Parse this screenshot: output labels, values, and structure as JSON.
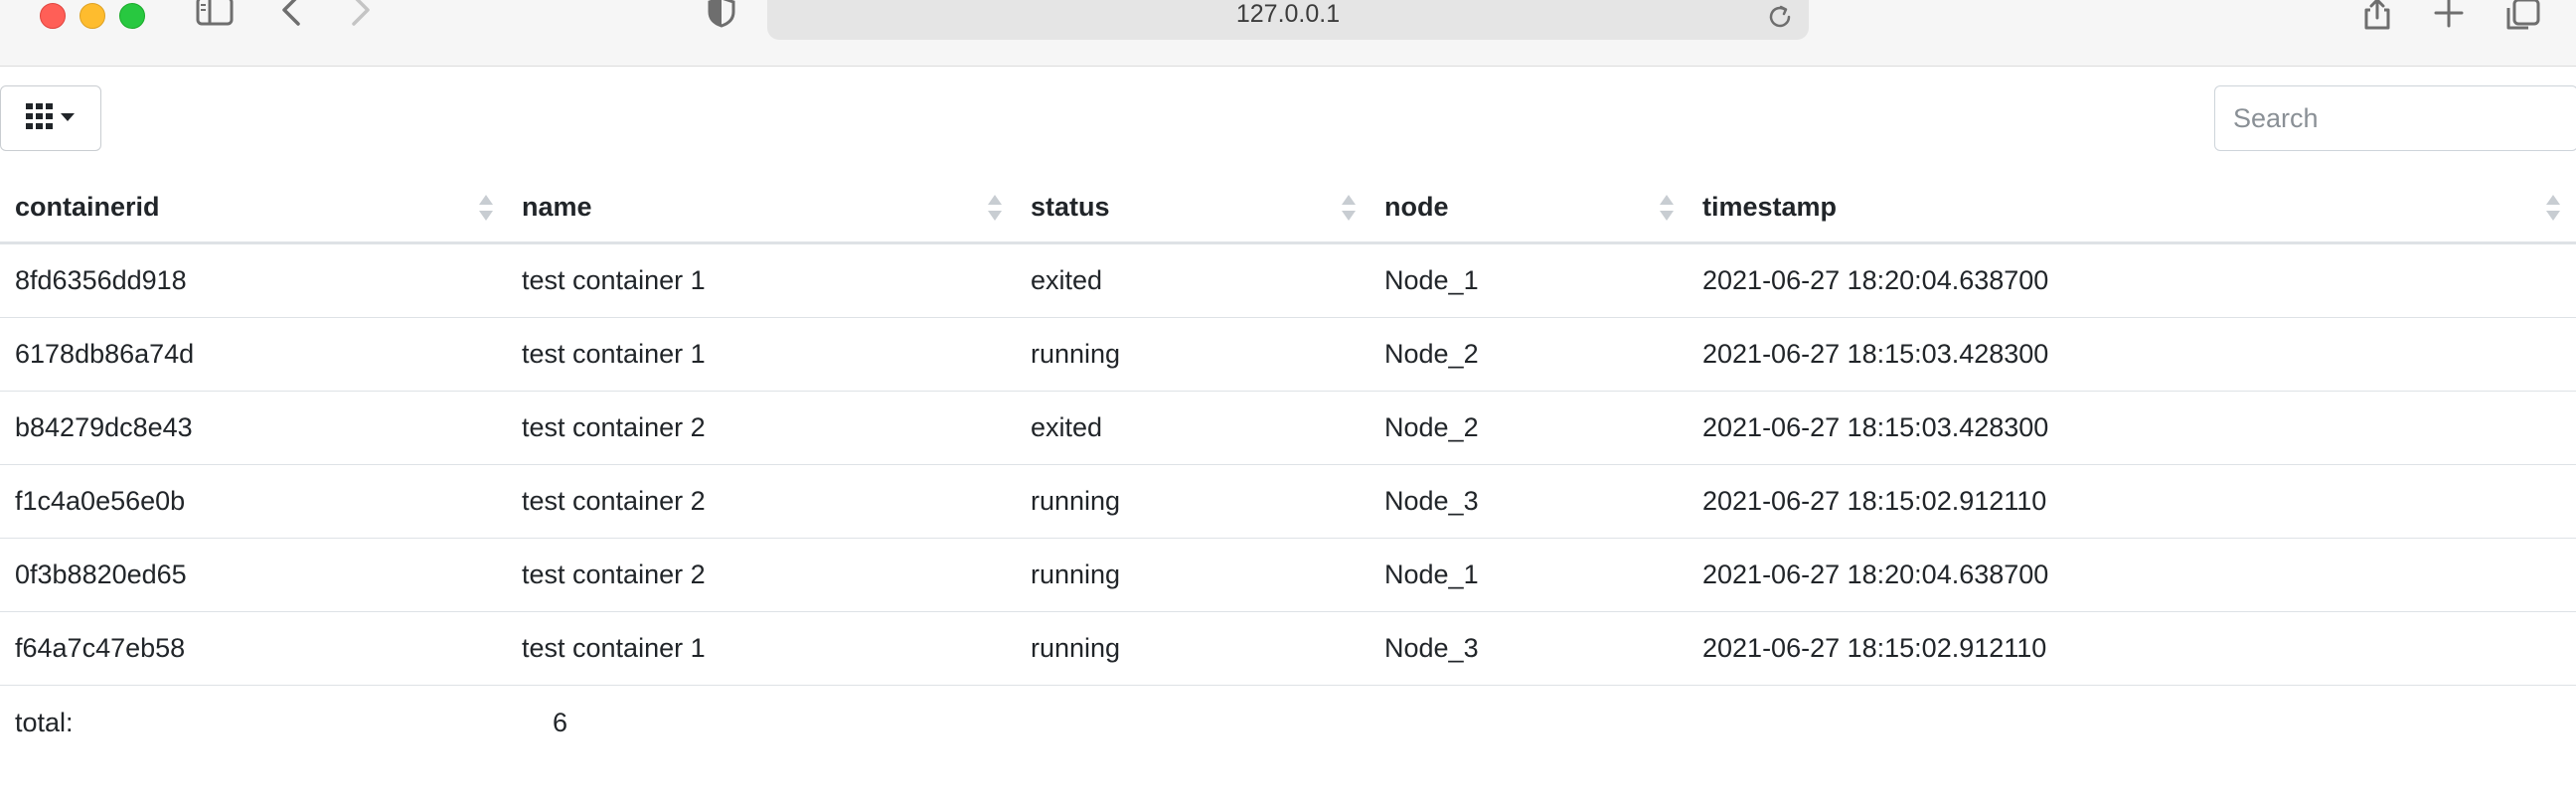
{
  "browser": {
    "url": "127.0.0.1"
  },
  "toolbar": {
    "search_placeholder": "Search"
  },
  "table": {
    "columns": [
      "containerid",
      "name",
      "status",
      "node",
      "timestamp"
    ],
    "rows": [
      [
        "8fd6356dd918",
        "test container 1",
        "exited",
        "Node_1",
        "2021-06-27 18:20:04.638700"
      ],
      [
        "6178db86a74d",
        "test container 1",
        "running",
        "Node_2",
        "2021-06-27 18:15:03.428300"
      ],
      [
        "b84279dc8e43",
        "test container 2",
        "exited",
        "Node_2",
        "2021-06-27 18:15:03.428300"
      ],
      [
        "f1c4a0e56e0b",
        "test container 2",
        "running",
        "Node_3",
        "2021-06-27 18:15:02.912110"
      ],
      [
        "0f3b8820ed65",
        "test container 2",
        "running",
        "Node_1",
        "2021-06-27 18:20:04.638700"
      ],
      [
        "f64a7c47eb58",
        "test container 1",
        "running",
        "Node_3",
        "2021-06-27 18:15:02.912110"
      ]
    ],
    "footer": {
      "total_label": "total:",
      "total_value": "6"
    }
  },
  "colors": {
    "close": "#ff5f57",
    "minimize": "#febc2e",
    "maximize": "#28c840",
    "border": "#dee2e6"
  },
  "icons": [
    "sidebar-icon",
    "back-icon",
    "forward-icon",
    "shield-icon",
    "reload-icon",
    "share-icon",
    "new-tab-icon",
    "tabs-overview-icon",
    "grid-icon",
    "caret-down-icon",
    "sort-icon"
  ]
}
